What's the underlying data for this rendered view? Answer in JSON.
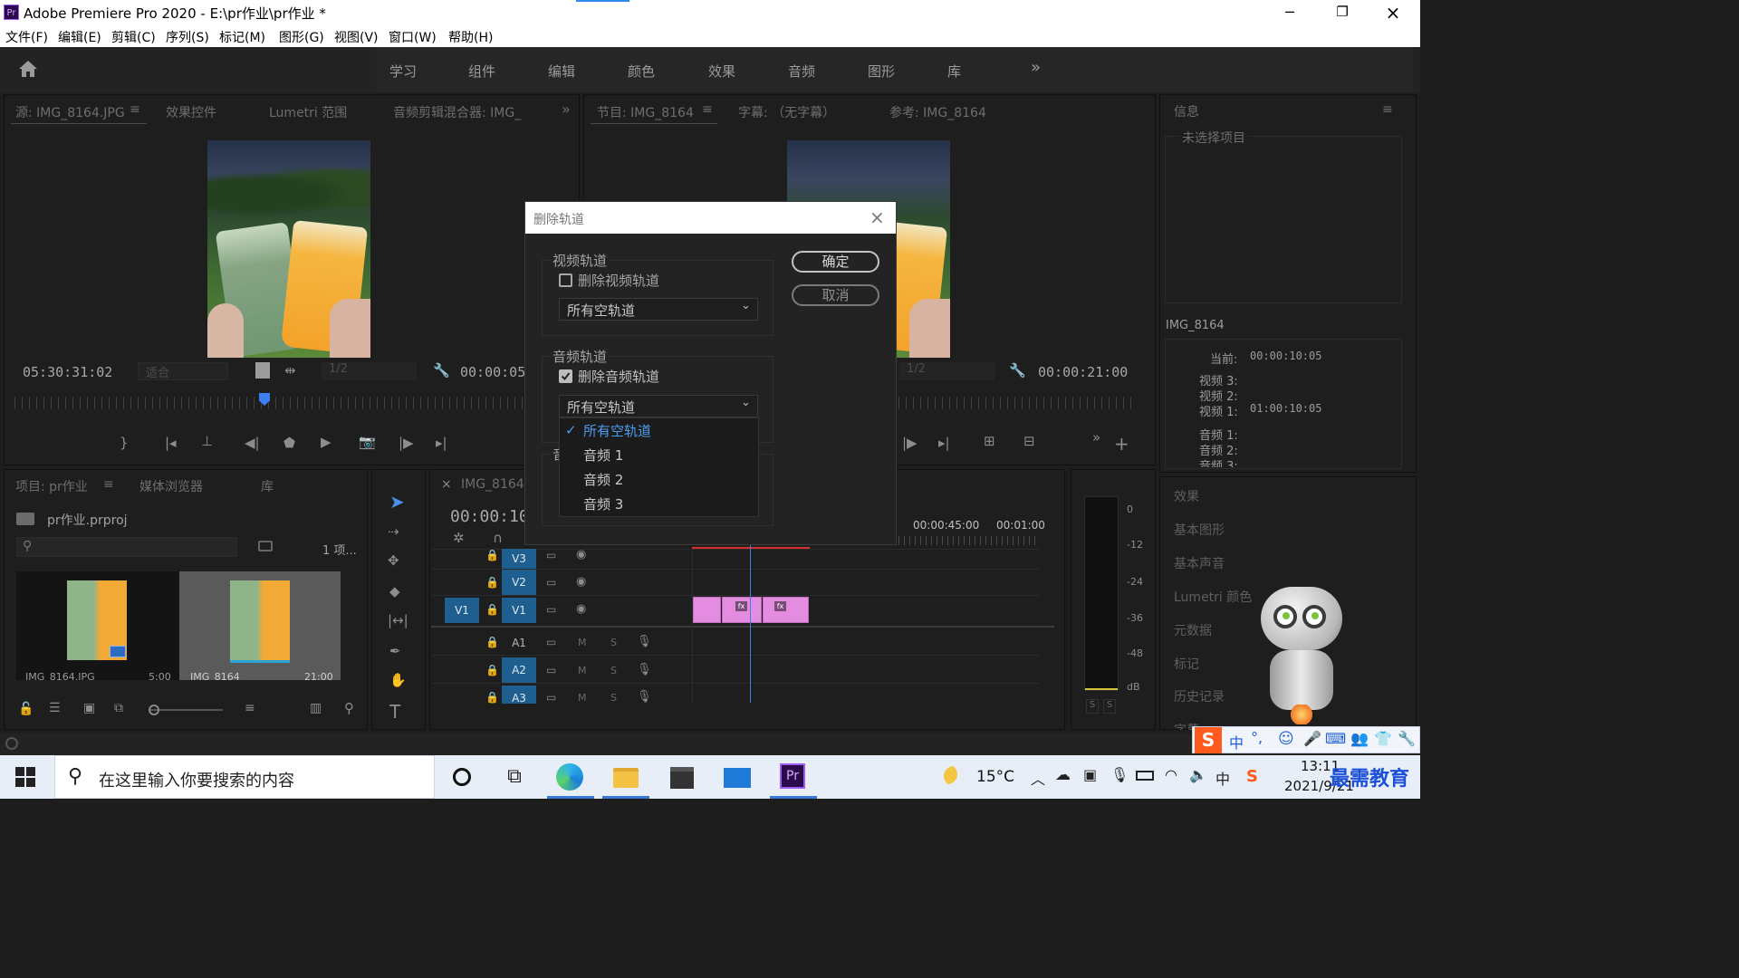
{
  "window": {
    "app_icon": "Pr",
    "title": "Adobe Premiere Pro 2020 - E:\\pr作业\\pr作业 *",
    "minimize_icon": "minimize-icon",
    "restore_icon": "restore-icon",
    "close_icon": "close-icon"
  },
  "menu": [
    "文件(F)",
    "编辑(E)",
    "剪辑(C)",
    "序列(S)",
    "标记(M)",
    "图形(G)",
    "视图(V)",
    "窗口(W)",
    "帮助(H)"
  ],
  "workspaces": [
    "学习",
    "组件",
    "编辑",
    "颜色",
    "效果",
    "音频",
    "图形",
    "库"
  ],
  "workspace_more": "»",
  "source_panel": {
    "tabs": [
      "源: IMG_8164.JPG",
      "效果控件",
      "Lumetri 范围",
      "音频剪辑混合器: IMG_"
    ],
    "menu_icon": "≡",
    "more": "»",
    "timecode": "05:30:31:02",
    "fit": "适合",
    "resolution": "1/2",
    "duration": "00:00:05"
  },
  "program_panel": {
    "tabs": [
      "节目: IMG_8164",
      "字幕: （无字幕）",
      "参考: IMG_8164"
    ],
    "menu_icon": "≡",
    "resolution": "1/2",
    "duration": "00:00:21:00",
    "more": "»",
    "add": "+"
  },
  "info_panel": {
    "title": "信息",
    "menu_icon": "≡",
    "no_selection": "未选择项目",
    "clip_name": "IMG_8164",
    "current_label": "当前:",
    "current_value": "00:00:10:05",
    "video3": "视频 3:",
    "video2": "视频 2:",
    "video1": "视频 1:",
    "video1_value": "01:00:10:05",
    "audio1": "音频 1:",
    "audio2": "音频 2:",
    "audio3": "音频 3:"
  },
  "side_panels": [
    "效果",
    "基本图形",
    "基本声音",
    "Lumetri 颜色",
    "元数据",
    "标记",
    "历史记录",
    "字幕"
  ],
  "project_panel": {
    "tabs": [
      "项目: pr作业",
      "媒体浏览器",
      "库"
    ],
    "menu_icon": "≡",
    "file": "pr作业.prproj",
    "count": "1 项...",
    "items": [
      {
        "name": "IMG_8164.JPG",
        "duration": "5:00"
      },
      {
        "name": "IMG_8164",
        "duration": "21:00"
      }
    ]
  },
  "timeline": {
    "close": "×",
    "tab": "IMG_8164",
    "timecode": "00:00:10:",
    "ruler": [
      "00:00:45:00",
      "00:01:00"
    ],
    "video_tracks": [
      "V3",
      "V2",
      "V1"
    ],
    "source_patch": "V1",
    "audio_tracks": [
      "A1",
      "A2",
      "A3"
    ],
    "m": "M",
    "s": "S",
    "fx": "fx"
  },
  "meter": {
    "scale": [
      "0",
      "-12",
      "-24",
      "-36",
      "-48",
      "dB"
    ],
    "solo": [
      "S",
      "S"
    ]
  },
  "dialog": {
    "title": "删除轨道",
    "video_group": "视频轨道",
    "delete_video": "删除视频轨道",
    "delete_video_checked": false,
    "video_select": "所有空轨道",
    "audio_group": "音频轨道",
    "delete_audio": "删除音频轨道",
    "delete_audio_checked": true,
    "audio_select": "所有空轨道",
    "partial_label": "音",
    "ok": "确定",
    "cancel": "取消",
    "dropdown_options": [
      "所有空轨道",
      "音频 1",
      "音频 2",
      "音频 3"
    ],
    "dropdown_selected": "所有空轨道"
  },
  "taskbar": {
    "search_placeholder": "在这里输入你要搜索的内容",
    "weather": "15°C",
    "time": "13:11",
    "date": "2021/9/21",
    "ime": "中",
    "watermark": "最需教育"
  },
  "colors": {
    "accent_blue": "#2d8ceb",
    "clip_pink": "#e48ce0",
    "track_blue": "#1f5f8f",
    "playhead": "#3c7ff0"
  }
}
